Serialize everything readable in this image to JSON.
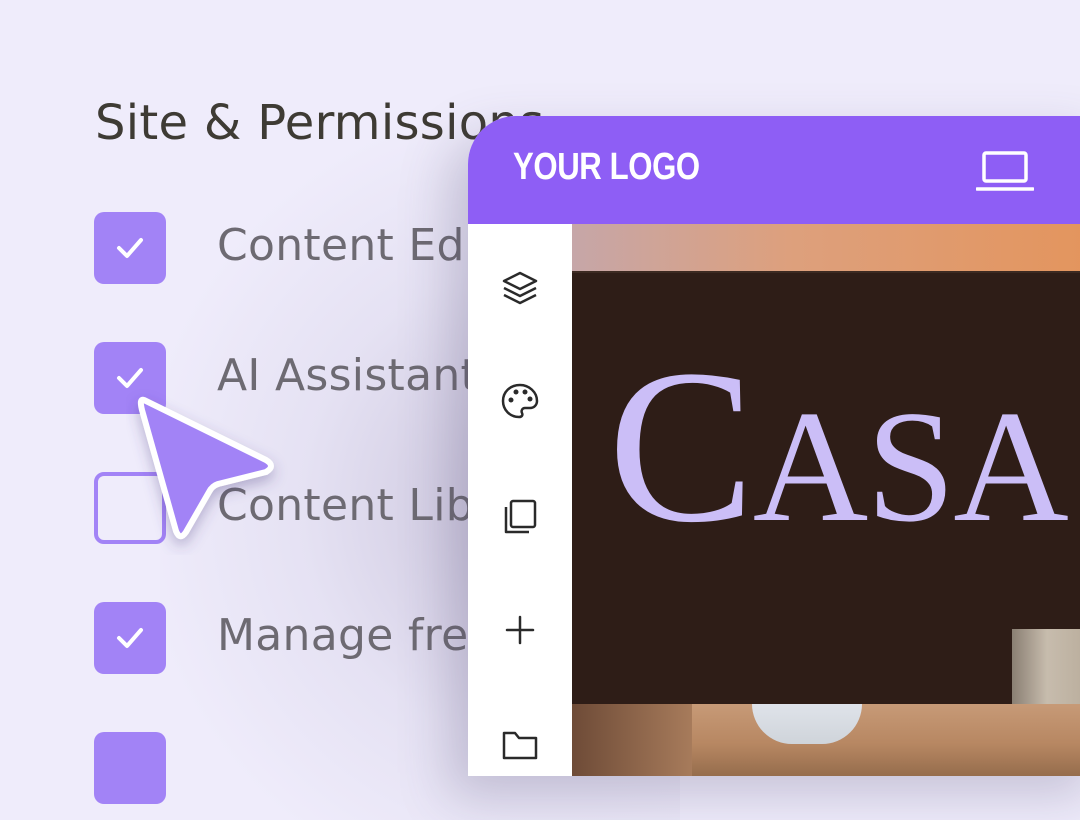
{
  "permissions": {
    "title": "Site & Permissions",
    "items": [
      {
        "label": "Content Editor",
        "checked": true
      },
      {
        "label": "AI Assistant",
        "checked": true
      },
      {
        "label": "Content Library",
        "checked": false
      },
      {
        "label": "Manage free",
        "checked": true
      },
      {
        "label": "",
        "checked": true
      }
    ]
  },
  "editor": {
    "logo": "YOUR LOGO",
    "device_icon": "laptop-icon",
    "sidebar_icons": [
      "layers-icon",
      "palette-icon",
      "copy-icon",
      "plus-icon",
      "folder-icon"
    ],
    "hero": {
      "first": "C",
      "rest": "ASA"
    }
  },
  "colors": {
    "accent": "#8e5ef5",
    "checkbox": "#a283f6",
    "canvas_bg": "#2e1d17",
    "hero_text": "#cbbef7"
  }
}
